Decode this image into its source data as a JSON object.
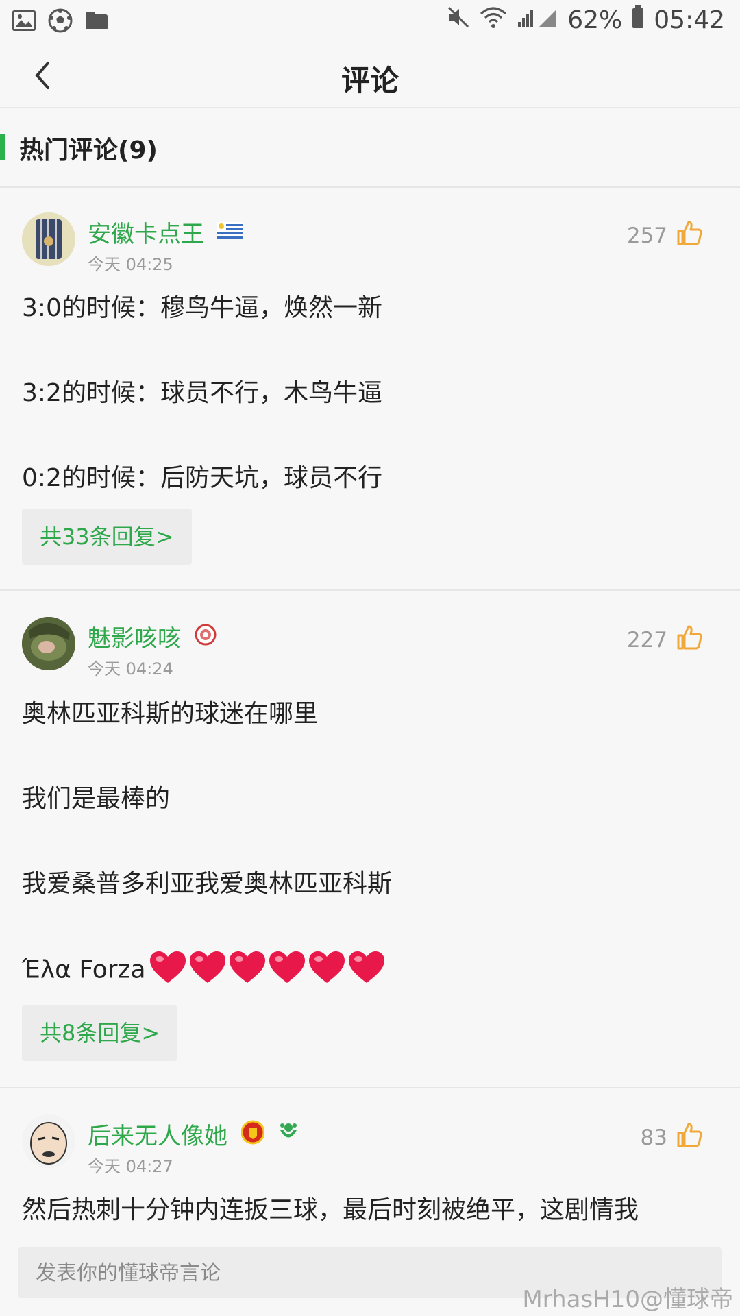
{
  "status_bar": {
    "battery_percent": "62%",
    "time": "05:42",
    "left_icons": [
      "gallery-icon",
      "soccer-ball-icon",
      "folder-icon"
    ],
    "right_icons": [
      "mute-icon",
      "wifi-icon",
      "signal-icon",
      "battery-icon"
    ]
  },
  "nav": {
    "title": "评论"
  },
  "section": {
    "label": "热门评论(9)"
  },
  "colors": {
    "green": "#2ea84a",
    "accent_bar": "#2bb24c",
    "like_orange": "#f0a83a",
    "heart_red": "#e8194a"
  },
  "comments": [
    {
      "username": "安徽卡点王",
      "time": "今天 04:25",
      "likes": "257",
      "badges": [
        "uruguay-flag-icon"
      ],
      "lines": [
        "3:0的时候：穆鸟牛逼，焕然一新",
        "3:2的时候：球员不行，木鸟牛逼",
        "0:2的时候：后防天坑，球员不行"
      ],
      "reply_label": "共33条回复>"
    },
    {
      "username": "魅影咳咳",
      "time": "今天 04:24",
      "likes": "227",
      "badges": [
        "olympiacos-badge-icon"
      ],
      "lines": [
        "奥林匹亚科斯的球迷在哪里",
        "我们是最棒的",
        "我爱桑普多利亚我爱奥林匹亚科斯",
        "Έλα Forza"
      ],
      "hearts_count": 6,
      "reply_label": "共8条回复>"
    },
    {
      "username": "后来无人像她",
      "time": "今天 04:27",
      "likes": "83",
      "badges": [
        "man-united-badge-icon",
        "green-club-badge-icon"
      ],
      "lines": [
        "然后热刺十分钟内连扳三球，最后时刻被绝平，这剧情我"
      ]
    }
  ],
  "input": {
    "placeholder": "发表你的懂球帝言论"
  },
  "watermark": "MrhasH10@懂球帝"
}
